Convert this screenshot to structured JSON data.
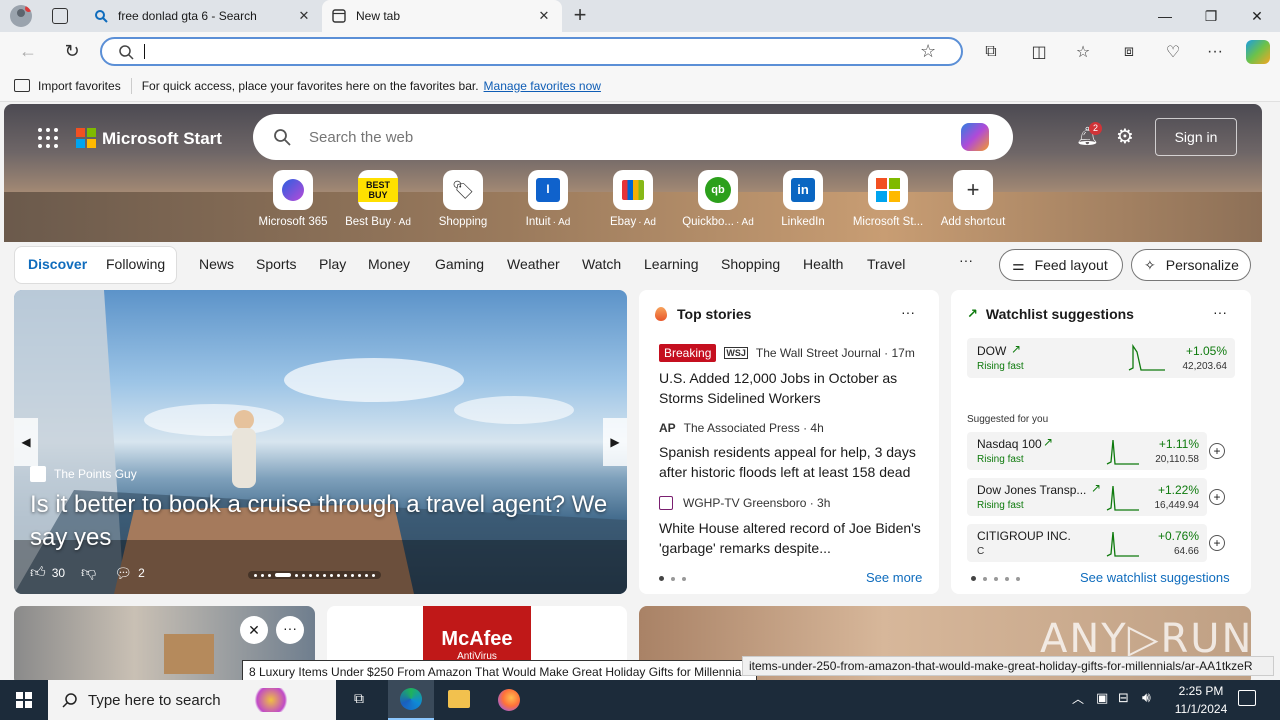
{
  "browser": {
    "tabs": [
      {
        "title": "free donlad gta 6 - Search",
        "icon": "search-icon",
        "active": false
      },
      {
        "title": "New tab",
        "icon": "newtab-icon",
        "active": true
      }
    ],
    "new_tab_symbol": "+",
    "address": {
      "value": "",
      "placeholder": ""
    }
  },
  "favorites_bar": {
    "import_label": "Import favorites",
    "hint": "For quick access, place your favorites here on the favorites bar.",
    "manage_link": "Manage favorites now"
  },
  "start": {
    "logo_text": "Microsoft Start",
    "search_placeholder": "Search the web",
    "notification_count": "2",
    "sign_in": "Sign in",
    "shortcuts": [
      {
        "label": "Microsoft 365",
        "ad": ""
      },
      {
        "label": "Best Buy",
        "ad": "· Ad"
      },
      {
        "label": "Shopping",
        "ad": ""
      },
      {
        "label": "Intuit",
        "ad": "· Ad"
      },
      {
        "label": "Ebay",
        "ad": "· Ad"
      },
      {
        "label": "Quickbo...",
        "ad": "· Ad"
      },
      {
        "label": "LinkedIn",
        "ad": ""
      },
      {
        "label": "Microsoft St...",
        "ad": ""
      },
      {
        "label": "Add shortcut",
        "ad": ""
      }
    ],
    "nav": {
      "discover": "Discover",
      "following": "Following",
      "items": [
        "News",
        "Sports",
        "Play",
        "Money",
        "Gaming",
        "Weather",
        "Watch",
        "Learning",
        "Shopping",
        "Health",
        "Travel"
      ],
      "more": "···",
      "feed_layout": "Feed layout",
      "personalize": "Personalize"
    }
  },
  "hero_story": {
    "source": "The Points Guy",
    "headline": "Is it better to book a cruise through a travel agent? We say yes",
    "likes": "30",
    "comments": "2"
  },
  "top_stories": {
    "title": "Top stories",
    "items": [
      {
        "badge": "Breaking",
        "source": "The Wall Street Journal · 17m",
        "headline": "U.S. Added 12,000 Jobs in October as Storms Sidelined Workers"
      },
      {
        "badge": "",
        "source": "The Associated Press · 4h",
        "headline": "Spanish residents appeal for help, 3 days after historic floods left at least 158 dead"
      },
      {
        "badge": "",
        "source": "WGHP-TV Greensboro · 3h",
        "headline": "White House altered record of Joe Biden's 'garbage' remarks despite..."
      }
    ],
    "see_more": "See more"
  },
  "watchlist": {
    "title": "Watchlist suggestions",
    "main": {
      "name": "DOW",
      "status": "Rising fast",
      "change": "+1.05%",
      "price": "42,203.64"
    },
    "suggested_label": "Suggested for you",
    "suggested": [
      {
        "name": "Nasdaq 100",
        "status": "Rising fast",
        "change": "+1.11%",
        "price": "20,110.58"
      },
      {
        "name": "Dow Jones Transp...",
        "status": "Rising fast",
        "change": "+1.22%",
        "price": "16,449.94"
      },
      {
        "name": "CITIGROUP INC.",
        "status": "C",
        "change": "+0.76%",
        "price": "64.66"
      }
    ],
    "see_all": "See watchlist suggestions"
  },
  "ad_card": {
    "brand": "McAfee",
    "sub": "AntiVirus"
  },
  "tooltip": "8 Luxury Items Under $250 From Amazon That Would Make Great Holiday Gifts for Millennials",
  "status_url": "items-under-250-from-amazon-that-would-make-great-holiday-gifts-for-millennials/ar-AA1tkzeR",
  "taskbar": {
    "search_placeholder": "Type here to search",
    "time": "2:25 PM",
    "date": "11/1/2024"
  },
  "colors": {
    "accent": "#0f6cbd",
    "breaking": "#c50f1f",
    "up": "#0e7a0d"
  }
}
